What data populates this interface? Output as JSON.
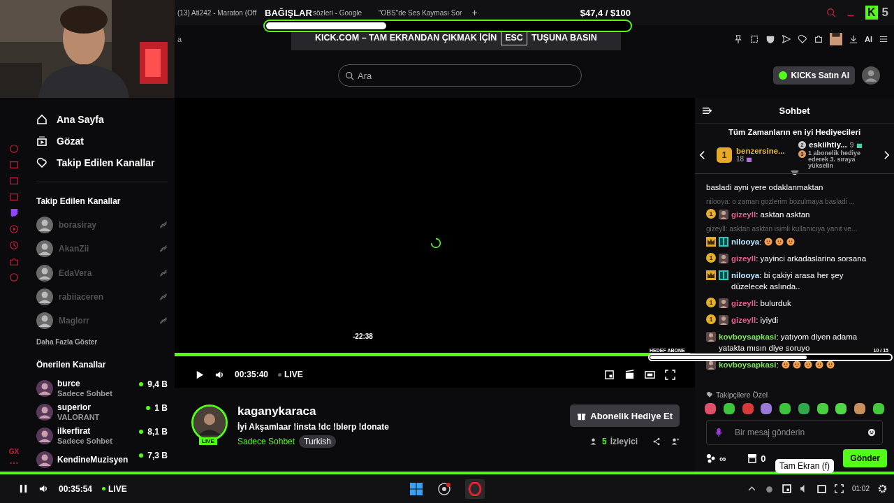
{
  "browser_tabs": [
    {
      "label": "(13) Ati242 - Maraton (Off"
    },
    {
      "label": "sözleri - Google"
    },
    {
      "label": "\"OBS\"de Ses Kayması Sor"
    }
  ],
  "tab_add": "+",
  "address_fragment": "a",
  "donation": {
    "title": "BAĞIŞLAR",
    "amount": "$47,4",
    "goal": "/ $100",
    "level": 0.33
  },
  "banner": {
    "before": "KICK.COM – TAM EKRANDAN ÇIKMAK İÇİN",
    "key": "ESC",
    "after": "TUŞUNA BASIN"
  },
  "kick_badge": {
    "letter": "K",
    "count": "5"
  },
  "toolbar": {
    "ai_label": "AI"
  },
  "search": {
    "placeholder": "Ara"
  },
  "buy_button": "KICKs Satın Al",
  "sidebar": {
    "rail_label": "GX",
    "nav": [
      {
        "label": "Ana Sayfa",
        "kind": "home"
      },
      {
        "label": "Gözat",
        "kind": "browse"
      },
      {
        "label": "Takip Edilen Kanallar",
        "kind": "heart"
      }
    ],
    "followed_title": "Takip Edilen Kanallar",
    "followed": [
      {
        "name": "borasiray",
        "offline": true
      },
      {
        "name": "AkanZii",
        "offline": true
      },
      {
        "name": "EdaVera",
        "offline": true
      },
      {
        "name": "rabiiaceren",
        "offline": true
      },
      {
        "name": "Maglorr",
        "offline": true
      }
    ],
    "show_more": "Daha Fazla Göster",
    "recommended_title": "Önerilen Kanallar",
    "recommended": [
      {
        "name": "burce",
        "category": "Sadece Sohbet",
        "viewers": "9,4 B"
      },
      {
        "name": "superior",
        "category": "VALORANT",
        "viewers": "1 B"
      },
      {
        "name": "ilkerfirat",
        "category": "Sadece Sohbet",
        "viewers": "8,1 B"
      },
      {
        "name": "KendineMuzisyen",
        "viewers": "7,3 B"
      }
    ]
  },
  "player": {
    "hover_time": "-22:38",
    "level": 0.99,
    "time": "00:35:40",
    "live": "LIVE"
  },
  "goal": {
    "title": "HEDEF ABONE",
    "count": "10 / 15",
    "level": 0.65
  },
  "channel": {
    "name": "kaganykaraca",
    "live_badge": "LIVE",
    "title": "İyi Akşamlaar !insta !dc !blerp !donate",
    "category": "Sadece Sohbet",
    "tag": "Turkish",
    "gift_button": "Abonelik Hediye Et",
    "viewers": "5",
    "viewers_label": "İzleyici"
  },
  "chat": {
    "title": "Sohbet",
    "gifters_title": "Tüm Zamanların en iyi Hediyecileri",
    "gifters": [
      {
        "rank": "1",
        "name": "benzersine...",
        "count": "18"
      },
      {
        "rank": "2",
        "name": "eskiihtiy...",
        "count": "9"
      }
    ],
    "next_rank": {
      "rank": "3",
      "text": "1 abonelik hediye ederek 3. sıraya yükselin"
    },
    "messages": [
      {
        "kind": "continuation",
        "text": "basladi ayni yere odaklanmaktan"
      },
      {
        "kind": "reply",
        "text": "nilooya: o zaman gozlerim bozulmaya basladi ..."
      },
      {
        "kind": "message",
        "badges": [
          {
            "kind": "rank",
            "label": "1"
          },
          {
            "kind": "avatar"
          }
        ],
        "user": "gizeyll",
        "color": "#e0608e",
        "text": ": asktan asktan"
      },
      {
        "kind": "reply",
        "text": "gizeyll: asktan asktan isimli kullanıcıya yanıt ve..."
      },
      {
        "kind": "message",
        "badges": [
          {
            "kind": "crown"
          },
          {
            "kind": "og"
          }
        ],
        "user": "nilooya",
        "color": "#bfe6ff",
        "text": ":",
        "emotes": [
          {
            "kind": "face"
          },
          {
            "kind": "face"
          },
          {
            "kind": "face"
          }
        ]
      },
      {
        "kind": "message",
        "badges": [
          {
            "kind": "rank",
            "label": "1"
          },
          {
            "kind": "avatar"
          }
        ],
        "user": "gizeyll",
        "color": "#e0608e",
        "text": ": yayinci arkadaslarina sorsana"
      },
      {
        "kind": "message",
        "badges": [
          {
            "kind": "crown"
          },
          {
            "kind": "og"
          }
        ],
        "user": "nilooya",
        "color": "#bfe6ff",
        "text": ": bi çakiyi arasa her şey düzelecek aslında.."
      },
      {
        "kind": "message",
        "badges": [
          {
            "kind": "rank",
            "label": "1"
          },
          {
            "kind": "avatar"
          }
        ],
        "user": "gizeyll",
        "color": "#e0608e",
        "text": ": bulurduk"
      },
      {
        "kind": "message",
        "badges": [
          {
            "kind": "rank",
            "label": "1"
          },
          {
            "kind": "avatar"
          }
        ],
        "user": "gizeyll",
        "color": "#e0608e",
        "text": ": iyiydi"
      },
      {
        "kind": "message",
        "badges": [
          {
            "kind": "avatar"
          }
        ],
        "user": "kovboysapkasi",
        "color": "#7fe05a",
        "text": ": yatıyom diyen adama yatakta mısın diye soruyo"
      },
      {
        "kind": "message",
        "badges": [
          {
            "kind": "avatar"
          }
        ],
        "user": "kovboysapkasi",
        "color": "#7fe05a",
        "text": ":",
        "emotes": [
          {
            "kind": "face"
          },
          {
            "kind": "face"
          },
          {
            "kind": "face"
          },
          {
            "kind": "face"
          },
          {
            "kind": "face"
          }
        ]
      }
    ],
    "emote_section": "Takipçilere Özel",
    "emote_picker": [
      {
        "color": "#e0506a"
      },
      {
        "color": "#3cc43c"
      },
      {
        "color": "#d83a3a"
      },
      {
        "color": "#9a7ad8"
      },
      {
        "color": "#3cc43c"
      },
      {
        "color": "#2ea84a"
      },
      {
        "color": "#48d040"
      },
      {
        "color": "#50d848"
      },
      {
        "color": "#c8905a"
      },
      {
        "color": "#44c83c"
      }
    ],
    "input": {
      "placeholder": "Bir mesaj gönderin"
    },
    "points": "∞",
    "store_count": "0",
    "send": "Gönder"
  },
  "bottom": {
    "time": "00:35:54",
    "live": "LIVE",
    "clock": "01:02",
    "tooltip": "Tam Ekran (f)"
  }
}
